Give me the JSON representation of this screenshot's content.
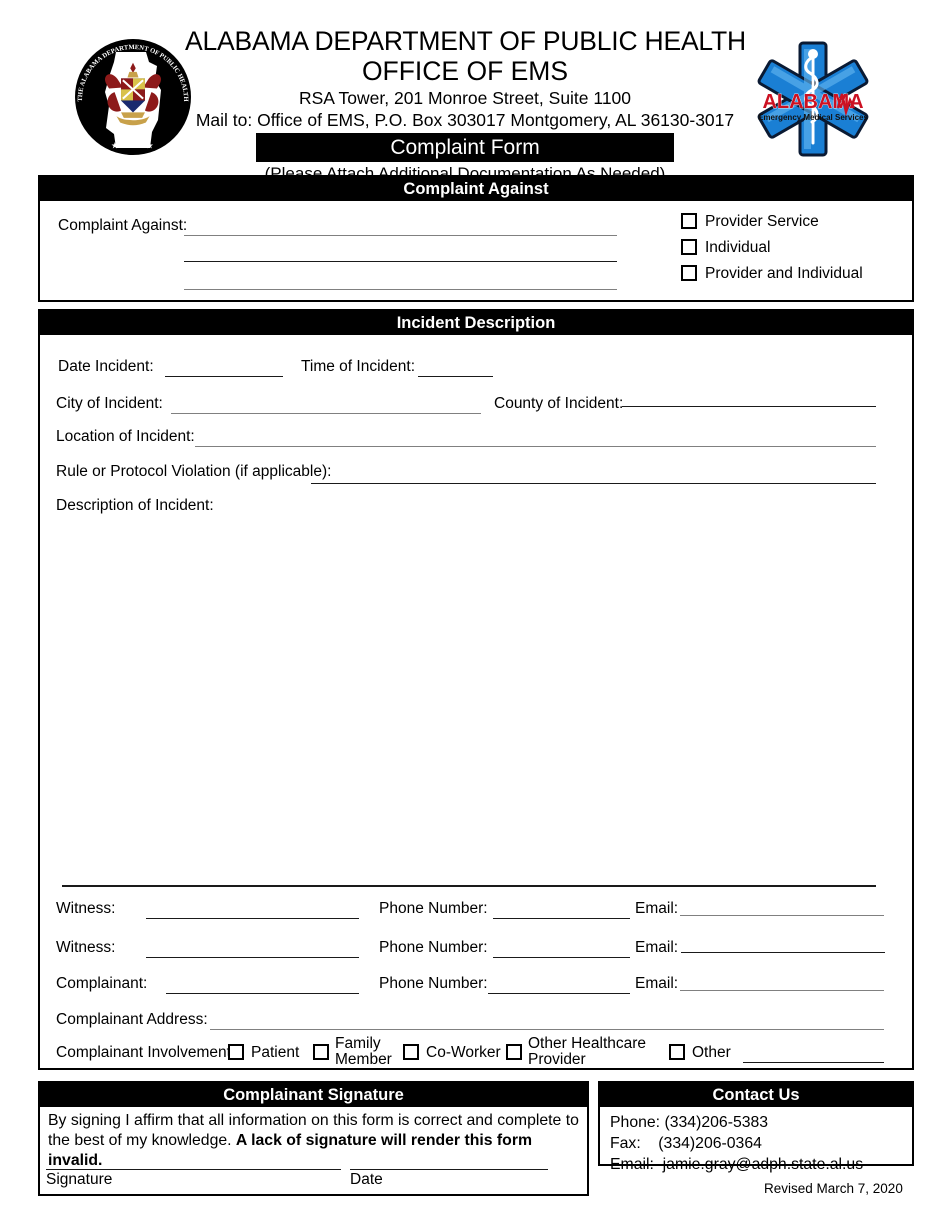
{
  "header": {
    "title_line1": "ALABAMA DEPARTMENT OF PUBLIC HEALTH",
    "title_line2": "OFFICE OF EMS",
    "address_line1": "RSA Tower, 201 Monroe Street, Suite 1100",
    "address_line2": "Mail to: Office of EMS, P.O. Box 303017 Montgomery, AL 36130-3017",
    "form_banner": "Complaint Form",
    "sub_note": "(Please Attach Additional Documentation As Needed)",
    "seal_icon": "adph-seal-icon",
    "seal_text_top": "THE ALABAMA DEPARTMENT OF PUBLIC HEALTH",
    "seal_year": "1875",
    "ems_logo_icon": "star-of-life-icon",
    "ems_logo_title": "ALABAMA",
    "ems_logo_sub": "Emergency Medical Services"
  },
  "complaint_against": {
    "section_title": "Complaint Against",
    "field_label": "Complaint Against:",
    "checkboxes": [
      {
        "label": "Provider Service",
        "checked": false
      },
      {
        "label": "Individual",
        "checked": false
      },
      {
        "label": "Provider and Individual",
        "checked": false
      }
    ]
  },
  "incident": {
    "section_title": "Incident Description",
    "date_label": "Date Incident:",
    "date_value": "",
    "time_label": "Time of Incident:",
    "time_value": "",
    "city_label": "City of Incident:",
    "city_value": "",
    "county_label": "County of Incident:",
    "county_value": "",
    "location_label": "Location of Incident:",
    "location_value": "",
    "rule_violation_label": "Rule or Protocol Violation (if applicable):",
    "rule_violation_value": "",
    "description_label": "Description of Incident:",
    "description_value": "",
    "witness_rows": [
      {
        "name_label": "Witness:",
        "name_value": "",
        "phone_label": "Phone Number:",
        "phone_value": "",
        "email_label": "Email:",
        "email_value": ""
      },
      {
        "name_label": "Witness:",
        "name_value": "",
        "phone_label": "Phone Number:",
        "phone_value": "",
        "email_label": "Email:",
        "email_value": ""
      },
      {
        "name_label": "Complainant:",
        "name_value": "",
        "phone_label": "Phone Number:",
        "phone_value": "",
        "email_label": "Email:",
        "email_value": ""
      }
    ],
    "address_label": "Complainant Address:",
    "address_value": "",
    "involvement_label": "Complainant Involvement:",
    "involvement_options": [
      {
        "label": "Patient",
        "checked": false
      },
      {
        "label": "Family Member",
        "checked": false
      },
      {
        "label": "Co-Worker",
        "checked": false
      },
      {
        "label": "Other Healthcare Provider",
        "checked": false
      },
      {
        "label": "Other",
        "checked": false
      }
    ],
    "involvement_other_value": ""
  },
  "signature": {
    "section_title": "Complainant Signature",
    "affirm_text_normal": "By signing I affirm that all information on this form is correct and complete to the best of my knowledge. ",
    "affirm_text_bold": "A lack of signature will render this form invalid.",
    "signature_label": "Signature",
    "signature_value": "",
    "date_label": "Date",
    "date_value": ""
  },
  "contact": {
    "section_title": "Contact Us",
    "phone_label": "Phone:",
    "phone_value": "(334)206-5383",
    "fax_label": "Fax:",
    "fax_value": "(334)206-0364",
    "email_label": "Email:",
    "email_value": "jamie.gray@adph.state.al.us",
    "body": "Phone: (334)206-5383\nFax:    (334)206-0364\nEmail:  jamie.gray@adph.state.al.us"
  },
  "footer": {
    "revised": "Revised March 7, 2020"
  },
  "colors": {
    "ink": "#000000",
    "rule_gray": "#808080",
    "banner_bg": "#000000",
    "banner_fg": "#ffffff",
    "ems_blue": "#1a7fd4",
    "ems_red": "#cc1122"
  }
}
